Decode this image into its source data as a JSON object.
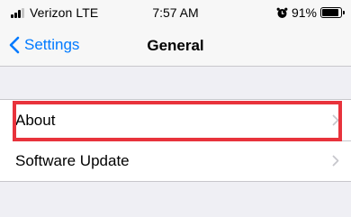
{
  "status_bar": {
    "carrier": "Verizon LTE",
    "time": "7:57 AM",
    "battery_percent": "91%",
    "battery_level": 0.91,
    "icons": [
      "signal-icon",
      "alarm-icon",
      "battery-icon"
    ]
  },
  "nav": {
    "back_label": "Settings",
    "title": "General"
  },
  "list": {
    "items": [
      {
        "label": "About",
        "highlighted": true
      },
      {
        "label": "Software Update",
        "highlighted": false
      }
    ]
  },
  "colors": {
    "accent": "#007aff",
    "highlight": "#e8333c",
    "background": "#efeff4"
  }
}
